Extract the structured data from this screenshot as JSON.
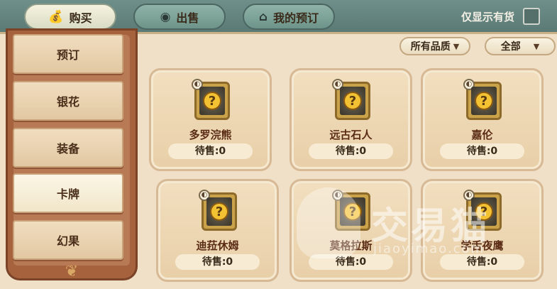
{
  "tabs": [
    {
      "label": "购买",
      "icon": "money-bag-icon",
      "active": true
    },
    {
      "label": "出售",
      "icon": "coins-icon",
      "active": false
    },
    {
      "label": "我的预订",
      "icon": "shop-icon",
      "active": false
    }
  ],
  "in_stock_label": "仅显示有货",
  "in_stock_checked": false,
  "sidebar": {
    "items": [
      {
        "label": "预订",
        "active": false
      },
      {
        "label": "银花",
        "active": false
      },
      {
        "label": "装备",
        "active": false
      },
      {
        "label": "卡牌",
        "active": true
      },
      {
        "label": "幻果",
        "active": false
      }
    ]
  },
  "filters": {
    "quality": "所有品质",
    "category": "全部"
  },
  "cards": [
    {
      "name": "多罗浣熊",
      "stock": "待售:0"
    },
    {
      "name": "远古石人",
      "stock": "待售:0"
    },
    {
      "name": "嘉伦",
      "stock": "待售:0"
    },
    {
      "name": "迪菈休姆",
      "stock": "待售:0"
    },
    {
      "name": "莫格拉斯",
      "stock": "待售:0"
    },
    {
      "name": "学舌夜鹰",
      "stock": "待售:0"
    }
  ],
  "watermark": {
    "title": "交易猫",
    "subtitle": "jiaoyimao.com"
  },
  "colors": {
    "topbar": "#5b7a76",
    "sidebar": "#a5623d",
    "panel": "#efe0c7",
    "accent_gold": "#f3c232"
  }
}
